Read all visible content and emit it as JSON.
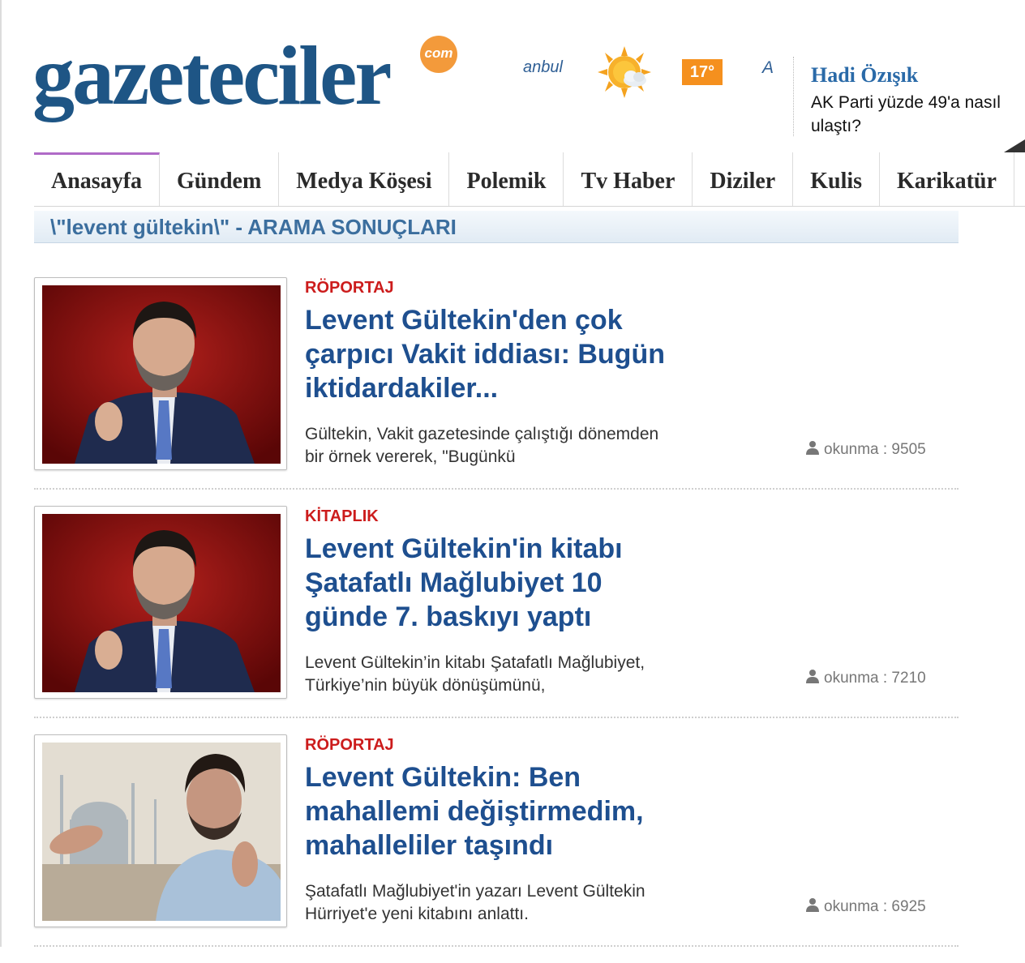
{
  "logo": {
    "name": "gazeteciler",
    "suffix": "com"
  },
  "weather": {
    "city": "anbul",
    "temperature": "17°",
    "letter": "A",
    "icon": "sun-cloud-icon"
  },
  "columnist": {
    "author": "Hadi Özışık",
    "headline": "AK Parti yüzde 49'a nasıl ulaştı?"
  },
  "nav": {
    "items": [
      {
        "label": "Anasayfa"
      },
      {
        "label": "Gündem"
      },
      {
        "label": "Medya Köşesi"
      },
      {
        "label": "Polemik"
      },
      {
        "label": "Tv Haber"
      },
      {
        "label": "Diziler"
      },
      {
        "label": "Kulis"
      },
      {
        "label": "Karikatür"
      }
    ],
    "active_index": 0,
    "active_color": "#b06bc7"
  },
  "search": {
    "title": "\\\"levent gültekin\\\" - ARAMA SONUÇLARI"
  },
  "articles": [
    {
      "category": "RÖPORTAJ",
      "title": "Levent Gültekin'den çok çarpıcı Vakit iddiası: Bugün iktidardakiler...",
      "summary": "Gültekin, Vakit gazetesinde çalıştığı dönemden bir örnek vererek, \"Bugünkü",
      "reads_label": "okunma : 9505"
    },
    {
      "category": "KİTAPLIK",
      "title": "Levent Gültekin'in kitabı Şatafatlı Mağlubiyet 10 günde 7. baskıyı yaptı",
      "summary": "Levent Gültekin’in kitabı Şatafatlı Mağlubiyet, Türkiye’nin büyük dönüşümünü,",
      "reads_label": "okunma : 7210"
    },
    {
      "category": "RÖPORTAJ",
      "title": "Levent Gültekin: Ben mahallemi değiştirmedim, mahalleliler taşındı",
      "summary": "Şatafatlı Mağlubiyet'in yazarı Levent Gültekin Hürriyet'e yeni kitabını anlattı.",
      "reads_label": "okunma : 6925"
    }
  ],
  "colors": {
    "brand": "#1e5585",
    "accent_orange": "#f5901e",
    "category_red": "#cc1c1c",
    "title_blue": "#1e4f8f"
  }
}
